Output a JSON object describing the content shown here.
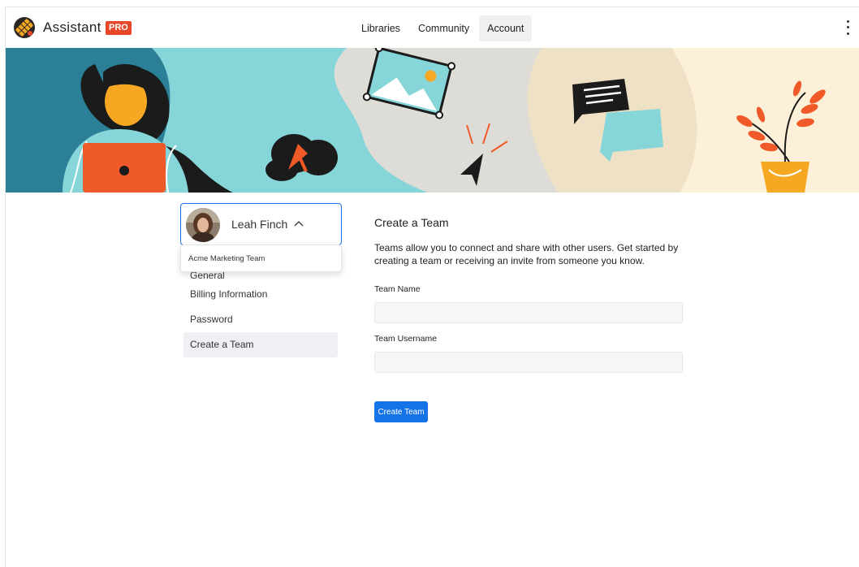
{
  "app": {
    "brand": "Assistant",
    "badge": "PRO"
  },
  "nav": {
    "links": [
      {
        "label": "Libraries"
      },
      {
        "label": "Community"
      },
      {
        "label": "Account"
      }
    ],
    "active": "Account"
  },
  "profile": {
    "name": "Leah Finch",
    "dropdown_items": [
      "Acme Marketing Team"
    ]
  },
  "sidebar": {
    "items": [
      {
        "label": "General"
      },
      {
        "label": "Billing Information"
      },
      {
        "label": "Password"
      },
      {
        "label": "Create a Team"
      }
    ],
    "active": "Create a Team"
  },
  "main": {
    "title": "Create a Team",
    "description": "Teams allow you to connect and share with other users. Get started by creating a team or receiving an invite from someone you know.",
    "fields": [
      {
        "label": "Team Name",
        "value": "",
        "placeholder": ""
      },
      {
        "label": "Team Username",
        "value": "",
        "placeholder": ""
      }
    ],
    "submit_label": "Create Team"
  },
  "colors": {
    "accent": "#1473e6",
    "badge": "#e8472a",
    "banner_teal": "#86d5d8",
    "banner_dark_teal": "#2b7f96",
    "banner_gray": "#dddcd6",
    "banner_cream": "#fcf0d8",
    "illustration_orange": "#f05a28"
  }
}
